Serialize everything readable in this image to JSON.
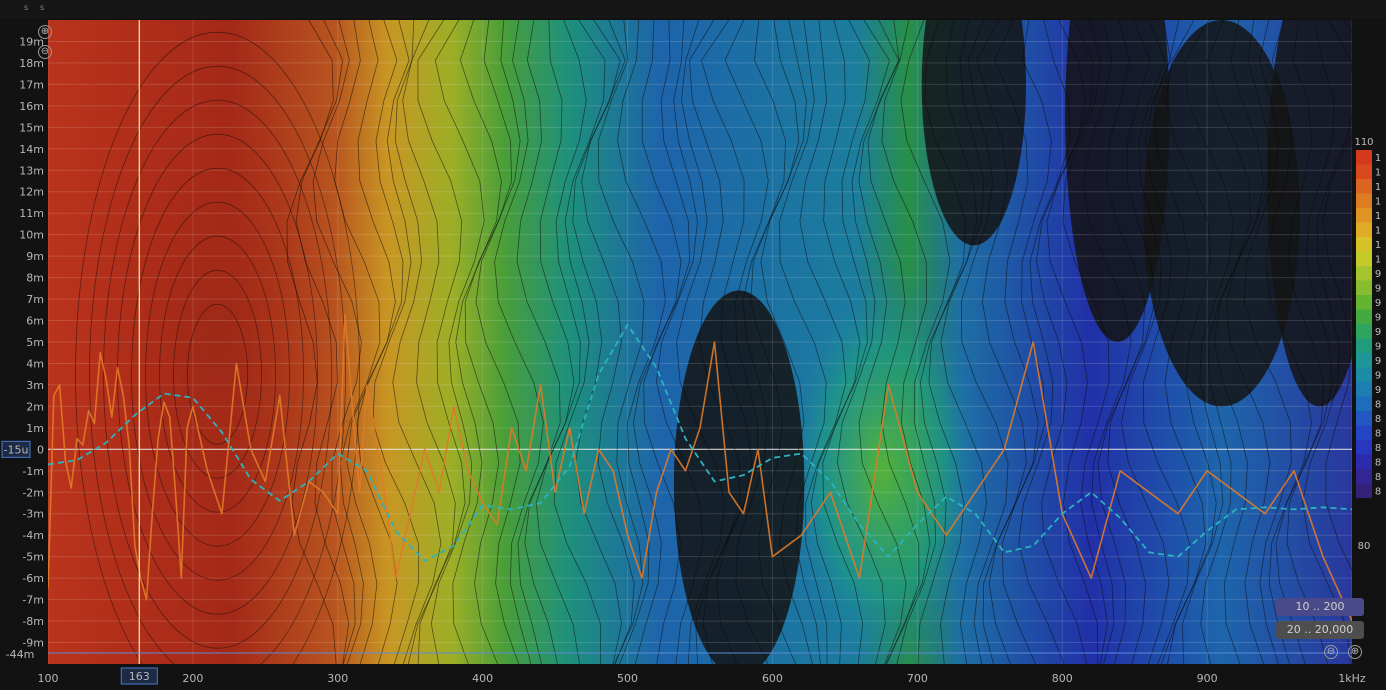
{
  "header": {
    "mark_a": "s",
    "mark_b": "s"
  },
  "y_axis": {
    "ticks": [
      {
        "v": 19,
        "label": "19m"
      },
      {
        "v": 18,
        "label": "18m"
      },
      {
        "v": 17,
        "label": "17m"
      },
      {
        "v": 16,
        "label": "16m"
      },
      {
        "v": 15,
        "label": "15m"
      },
      {
        "v": 14,
        "label": "14m"
      },
      {
        "v": 13,
        "label": "13m"
      },
      {
        "v": 12,
        "label": "12m"
      },
      {
        "v": 11,
        "label": "11m"
      },
      {
        "v": 10,
        "label": "10m"
      },
      {
        "v": 9,
        "label": "9m"
      },
      {
        "v": 8,
        "label": "8m"
      },
      {
        "v": 7,
        "label": "7m"
      },
      {
        "v": 6,
        "label": "6m"
      },
      {
        "v": 5,
        "label": "5m"
      },
      {
        "v": 4,
        "label": "4m"
      },
      {
        "v": 3,
        "label": "3m"
      },
      {
        "v": 2,
        "label": "2m"
      },
      {
        "v": 1,
        "label": "1m"
      },
      {
        "v": 0,
        "label": "0"
      },
      {
        "v": -1,
        "label": "-1m"
      },
      {
        "v": -2,
        "label": "-2m"
      },
      {
        "v": -3,
        "label": "-3m"
      },
      {
        "v": -4,
        "label": "-4m"
      },
      {
        "v": -5,
        "label": "-5m"
      },
      {
        "v": -6,
        "label": "-6m"
      },
      {
        "v": -7,
        "label": "-7m"
      },
      {
        "v": -8,
        "label": "-8m"
      },
      {
        "v": -9,
        "label": "-9m"
      }
    ],
    "cursor_value": "-15u",
    "bottom_value": "-44m"
  },
  "x_axis": {
    "ticks": [
      {
        "v": 100,
        "label": "100"
      },
      {
        "v": 200,
        "label": "200"
      },
      {
        "v": 300,
        "label": "300"
      },
      {
        "v": 400,
        "label": "400"
      },
      {
        "v": 500,
        "label": "500"
      },
      {
        "v": 600,
        "label": "600"
      },
      {
        "v": 700,
        "label": "700"
      },
      {
        "v": 800,
        "label": "800"
      },
      {
        "v": 900,
        "label": "900"
      },
      {
        "v": 1000,
        "label": "1kHz"
      }
    ],
    "cursor_value": "163",
    "unit": "kHz"
  },
  "color_scale": {
    "max_label": "110",
    "min_label": "80",
    "bands": [
      {
        "color": "#d33a1c",
        "label": "1"
      },
      {
        "color": "#d84a1e",
        "label": "1"
      },
      {
        "color": "#dc6420",
        "label": "1"
      },
      {
        "color": "#de7c22",
        "label": "1"
      },
      {
        "color": "#e09424",
        "label": "1"
      },
      {
        "color": "#e0ab26",
        "label": "1"
      },
      {
        "color": "#d8c22a",
        "label": "1"
      },
      {
        "color": "#c4cc2c",
        "label": "1"
      },
      {
        "color": "#a6c42c",
        "label": "9"
      },
      {
        "color": "#86bc2e",
        "label": "9"
      },
      {
        "color": "#64b432",
        "label": "9"
      },
      {
        "color": "#44aa40",
        "label": "9"
      },
      {
        "color": "#2ea45c",
        "label": "9"
      },
      {
        "color": "#209c7c",
        "label": "9"
      },
      {
        "color": "#1c9696",
        "label": "9"
      },
      {
        "color": "#1c8ca6",
        "label": "9"
      },
      {
        "color": "#1e7eb4",
        "label": "9"
      },
      {
        "color": "#206cbc",
        "label": "8"
      },
      {
        "color": "#2258c2",
        "label": "8"
      },
      {
        "color": "#2446c4",
        "label": "8"
      },
      {
        "color": "#2836c0",
        "label": "8"
      },
      {
        "color": "#2e2aae",
        "label": "8"
      },
      {
        "color": "#332594",
        "label": "8"
      },
      {
        "color": "#34217a",
        "label": "8"
      }
    ]
  },
  "controls": {
    "range_a": "10 .. 200",
    "range_b": "20 .. 20,000",
    "zoom_in": "⊕",
    "zoom_out": "⊖"
  },
  "chart_data": {
    "type": "heatmap",
    "x_scale": "linear",
    "x_range": [
      100,
      1000
    ],
    "y_range": [
      -10,
      20
    ],
    "y_unit": "m",
    "color_range": [
      80,
      110
    ],
    "cursor": {
      "x": 163,
      "y": 0
    },
    "series": [
      {
        "kind": "contour-spectrogram"
      },
      {
        "kind": "trace",
        "color": "#e07a28",
        "x": [
          100,
          104,
          108,
          112,
          116,
          120,
          124,
          128,
          132,
          136,
          140,
          144,
          148,
          152,
          156,
          160,
          164,
          168,
          172,
          176,
          180,
          184,
          188,
          192,
          196,
          200,
          210,
          220,
          230,
          240,
          250,
          260,
          270,
          280,
          290,
          300,
          305,
          310,
          315,
          320,
          330,
          340,
          350,
          360,
          370,
          380,
          390,
          400,
          410,
          420,
          430,
          440,
          450,
          460,
          470,
          480,
          490,
          500,
          510,
          520,
          530,
          540,
          550,
          560,
          570,
          580,
          590,
          600,
          620,
          640,
          660,
          680,
          700,
          720,
          740,
          760,
          780,
          800,
          820,
          840,
          860,
          880,
          900,
          920,
          940,
          960,
          980,
          1000
        ],
        "y": [
          -6.5,
          2.5,
          3,
          -0.5,
          -1.8,
          0.5,
          0.2,
          1.8,
          1.2,
          4.5,
          3.3,
          1.5,
          3.8,
          2.5,
          0.2,
          -4.5,
          -6,
          -7,
          -3,
          0.5,
          2.2,
          1.5,
          -2,
          -6,
          1,
          2,
          -1,
          -3,
          4,
          0,
          -1.5,
          2.5,
          -4,
          -1.5,
          -2,
          -3,
          6.3,
          2,
          -2,
          3,
          -1,
          -6,
          -3,
          0,
          -2,
          2,
          -1,
          -2.5,
          -3.5,
          1,
          -1,
          3,
          -2,
          1,
          -3,
          0,
          -1,
          -4,
          -6,
          -2,
          0,
          -1,
          1,
          5,
          -2,
          -3,
          0,
          -5,
          -4,
          -2,
          -6,
          3,
          -2,
          -4,
          -2,
          0,
          5,
          -3,
          -6,
          -1,
          -2,
          -3,
          -1,
          -2,
          -3,
          -1,
          -5,
          -8
        ]
      },
      {
        "kind": "smoothed",
        "color": "#2bb3c0",
        "x": [
          100,
          120,
          140,
          160,
          180,
          200,
          220,
          240,
          260,
          280,
          300,
          320,
          340,
          360,
          380,
          400,
          420,
          440,
          460,
          480,
          500,
          520,
          540,
          560,
          580,
          600,
          620,
          640,
          660,
          680,
          700,
          720,
          740,
          760,
          780,
          800,
          820,
          840,
          860,
          880,
          900,
          920,
          940,
          960,
          980,
          1000
        ],
        "y": [
          -0.7,
          -0.5,
          0.3,
          1.6,
          2.6,
          2.4,
          0.8,
          -1.4,
          -2.4,
          -1.5,
          -0.2,
          -1.0,
          -3.8,
          -5.2,
          -4.5,
          -2.6,
          -2.8,
          -2.5,
          -0.8,
          3.5,
          5.8,
          3.8,
          0.5,
          -1.5,
          -1.2,
          -0.4,
          -0.2,
          -1.5,
          -3.5,
          -5.0,
          -3.5,
          -2.2,
          -3.0,
          -4.8,
          -4.5,
          -3.0,
          -2.0,
          -3.2,
          -4.8,
          -5.0,
          -3.8,
          -2.8,
          -2.7,
          -2.8,
          -2.7,
          -2.8
        ]
      }
    ]
  }
}
